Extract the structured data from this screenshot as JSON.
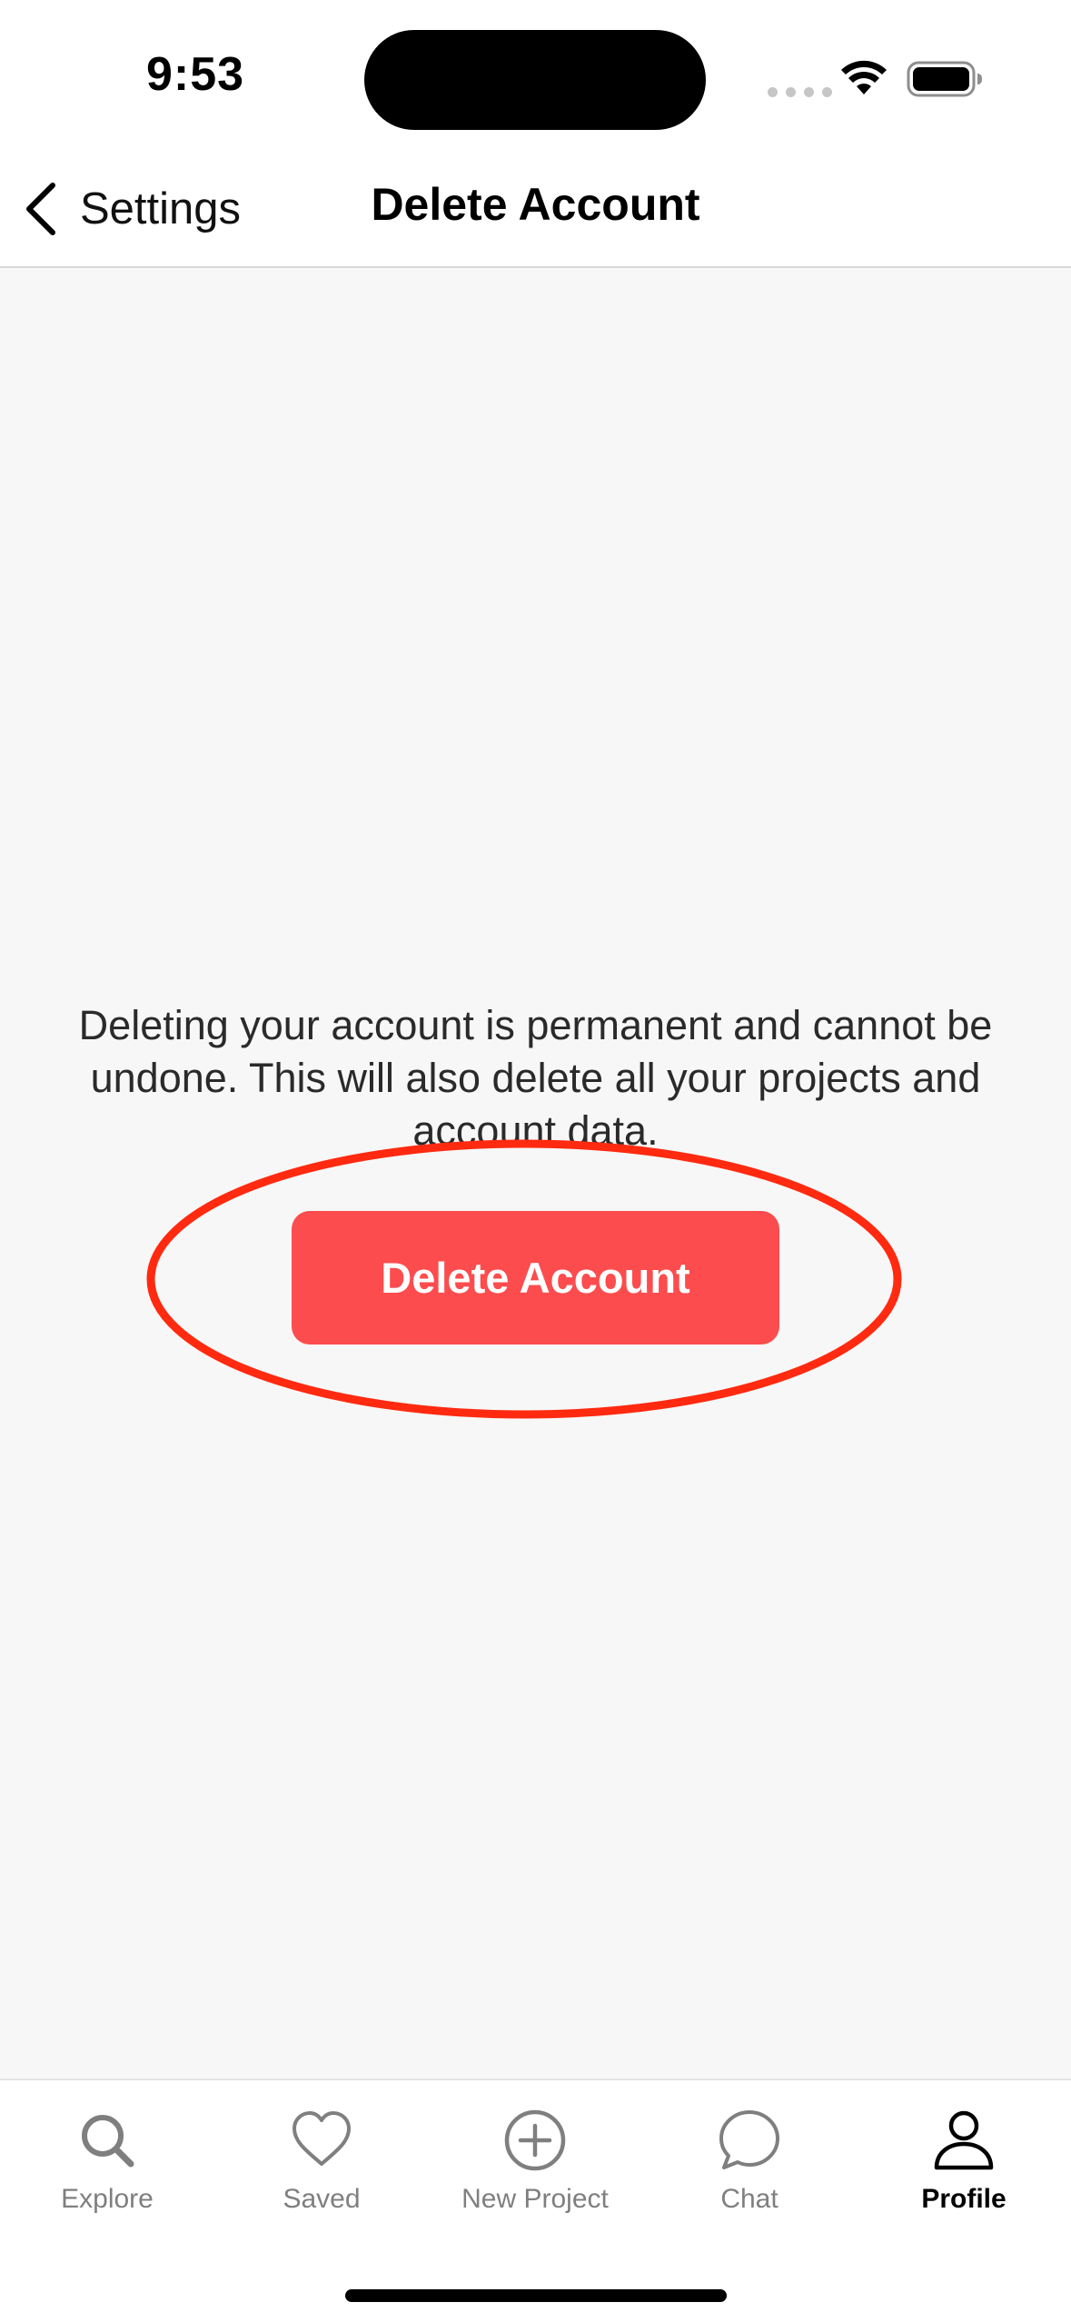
{
  "status_bar": {
    "time": "9:53"
  },
  "nav": {
    "back_label": "Settings",
    "title": "Delete Account"
  },
  "content": {
    "warning": "Deleting your account is permanent and cannot be undone. This will also delete all your projects and account data.",
    "delete_button_label": "Delete Account"
  },
  "tabs": [
    {
      "label": "Explore",
      "icon": "search-icon",
      "active": false
    },
    {
      "label": "Saved",
      "icon": "heart-icon",
      "active": false
    },
    {
      "label": "New Project",
      "icon": "plus-circle-icon",
      "active": false
    },
    {
      "label": "Chat",
      "icon": "chat-bubble-icon",
      "active": false
    },
    {
      "label": "Profile",
      "icon": "person-icon",
      "active": true
    }
  ],
  "colors": {
    "destructive": "#fc4c4e",
    "annotation": "#ff2a10",
    "content_background": "#f7f7f7",
    "inactive_tab": "#7f7f7f"
  }
}
